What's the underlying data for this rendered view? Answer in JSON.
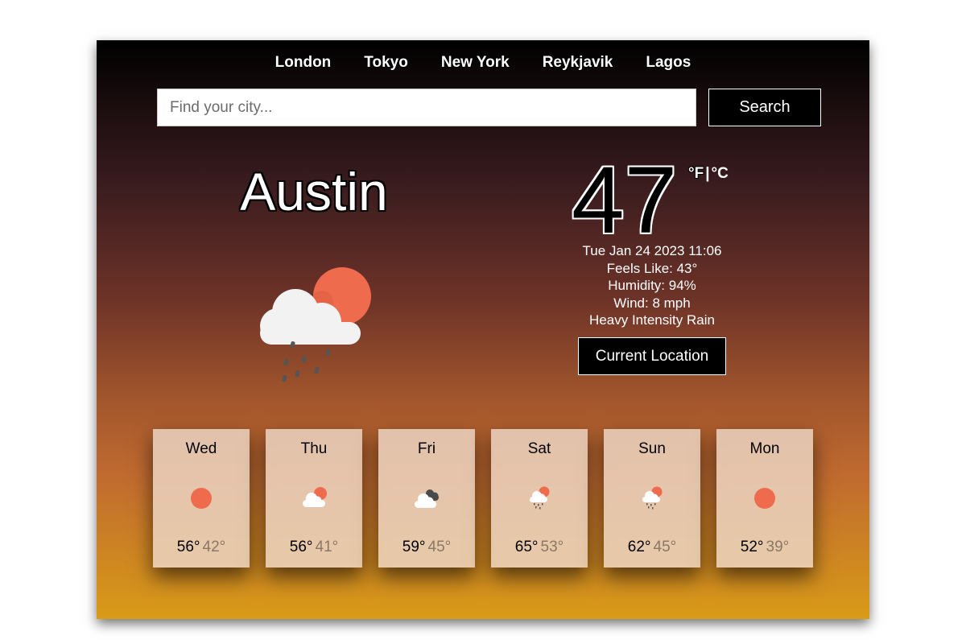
{
  "nav": {
    "cities": [
      "London",
      "Tokyo",
      "New York",
      "Reykjavik",
      "Lagos"
    ]
  },
  "search": {
    "placeholder": "Find your city...",
    "button_label": "Search"
  },
  "current": {
    "city": "Austin",
    "temperature": "47",
    "unit_f": "°F",
    "unit_separator": "|",
    "unit_c": "°C",
    "datetime": "Tue Jan 24 2023 11:06",
    "feels_like": "Feels Like: 43°",
    "humidity": "Humidity: 94%",
    "wind": "Wind: 8 mph",
    "description": "Heavy Intensity Rain",
    "icon": "rain-cloud-sun-icon",
    "location_button_label": "Current Location"
  },
  "forecast": [
    {
      "day": "Wed",
      "high": "56°",
      "low": "42°",
      "icon": "sun-icon"
    },
    {
      "day": "Thu",
      "high": "56°",
      "low": "41°",
      "icon": "cloud-sun-icon"
    },
    {
      "day": "Fri",
      "high": "59°",
      "low": "45°",
      "icon": "cloudy-icon"
    },
    {
      "day": "Sat",
      "high": "65°",
      "low": "53°",
      "icon": "rain-cloud-sun-icon"
    },
    {
      "day": "Sun",
      "high": "62°",
      "low": "45°",
      "icon": "rain-cloud-sun-icon"
    },
    {
      "day": "Mon",
      "high": "52°",
      "low": "39°",
      "icon": "sun-icon"
    }
  ],
  "colors": {
    "sun": "#ee6b4d",
    "cloud": "#f2f2f2",
    "dark_cloud": "#4a4a4a",
    "rain": "#555555"
  }
}
